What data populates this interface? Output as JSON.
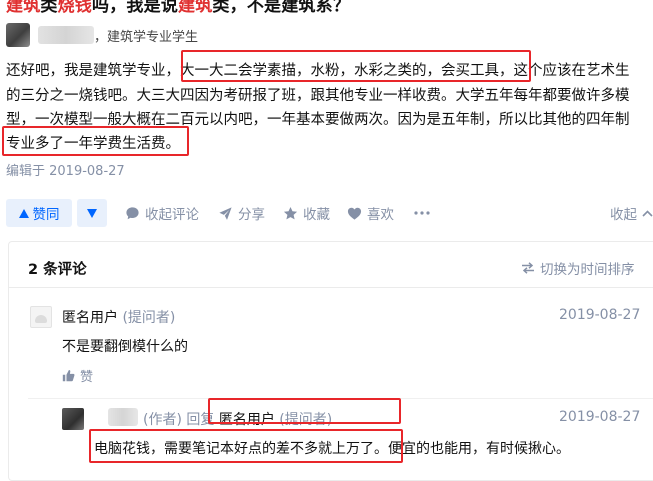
{
  "question": {
    "title_parts": [
      {
        "text": "建筑",
        "red": true
      },
      {
        "text": "类",
        "red": false
      },
      {
        "text": "烧钱",
        "red": true
      },
      {
        "text": "吗，我是说",
        "red": false
      },
      {
        "text": "建筑",
        "red": true
      },
      {
        "text": "类，不是建筑系？",
        "red": false
      }
    ]
  },
  "author": {
    "meta": "，建筑学专业学生"
  },
  "answer": {
    "lines": [
      "还好吧，我是建筑学专业，大一大二会学素描，水粉，水彩之类的，会买工具，这个应该在艺术生",
      "的三分之一烧钱吧。大三大四因为考研报了班，跟其他专业一样收费。大学五年每年都要做许多模",
      "型，一次模型一般大概在二百元以内吧，一年基本要做两次。因为是五年制，所以比其他的四年制",
      "专业多了一年学费生活费。"
    ],
    "edit_time": "编辑于 2019-08-27"
  },
  "actions": {
    "vote_label": "赞同",
    "vote_icon": "triangle-up-icon",
    "downvote_icon": "triangle-down-icon",
    "comment_label": "收起评论",
    "share_label": "分享",
    "favorite_label": "收藏",
    "like_label": "喜欢",
    "more_icon": "ellipsis-icon",
    "collapse_label": "收起",
    "collapse_icon": "chevron-up-icon"
  },
  "comments": {
    "count_label": "2 条评论",
    "sort_label": "切换为时间排序",
    "items": [
      {
        "name": "匿名用户",
        "tag": "(提问者)",
        "date": "2019-08-27",
        "text": "不是要翻倒模什么的",
        "like_label": "赞"
      },
      {
        "tag": "(作者) 回复",
        "reply_to": "匿名用户",
        "reply_tag": "(提问者)",
        "date": "2019-08-27",
        "text": "电脑花钱，需要笔记本好点的差不多就上万了。便宜的也能用，有时候揪心。"
      }
    ]
  },
  "colors": {
    "accent_blue": "#0066ff",
    "highlight_red": "#e8262a",
    "muted_gray": "#8590a6"
  }
}
